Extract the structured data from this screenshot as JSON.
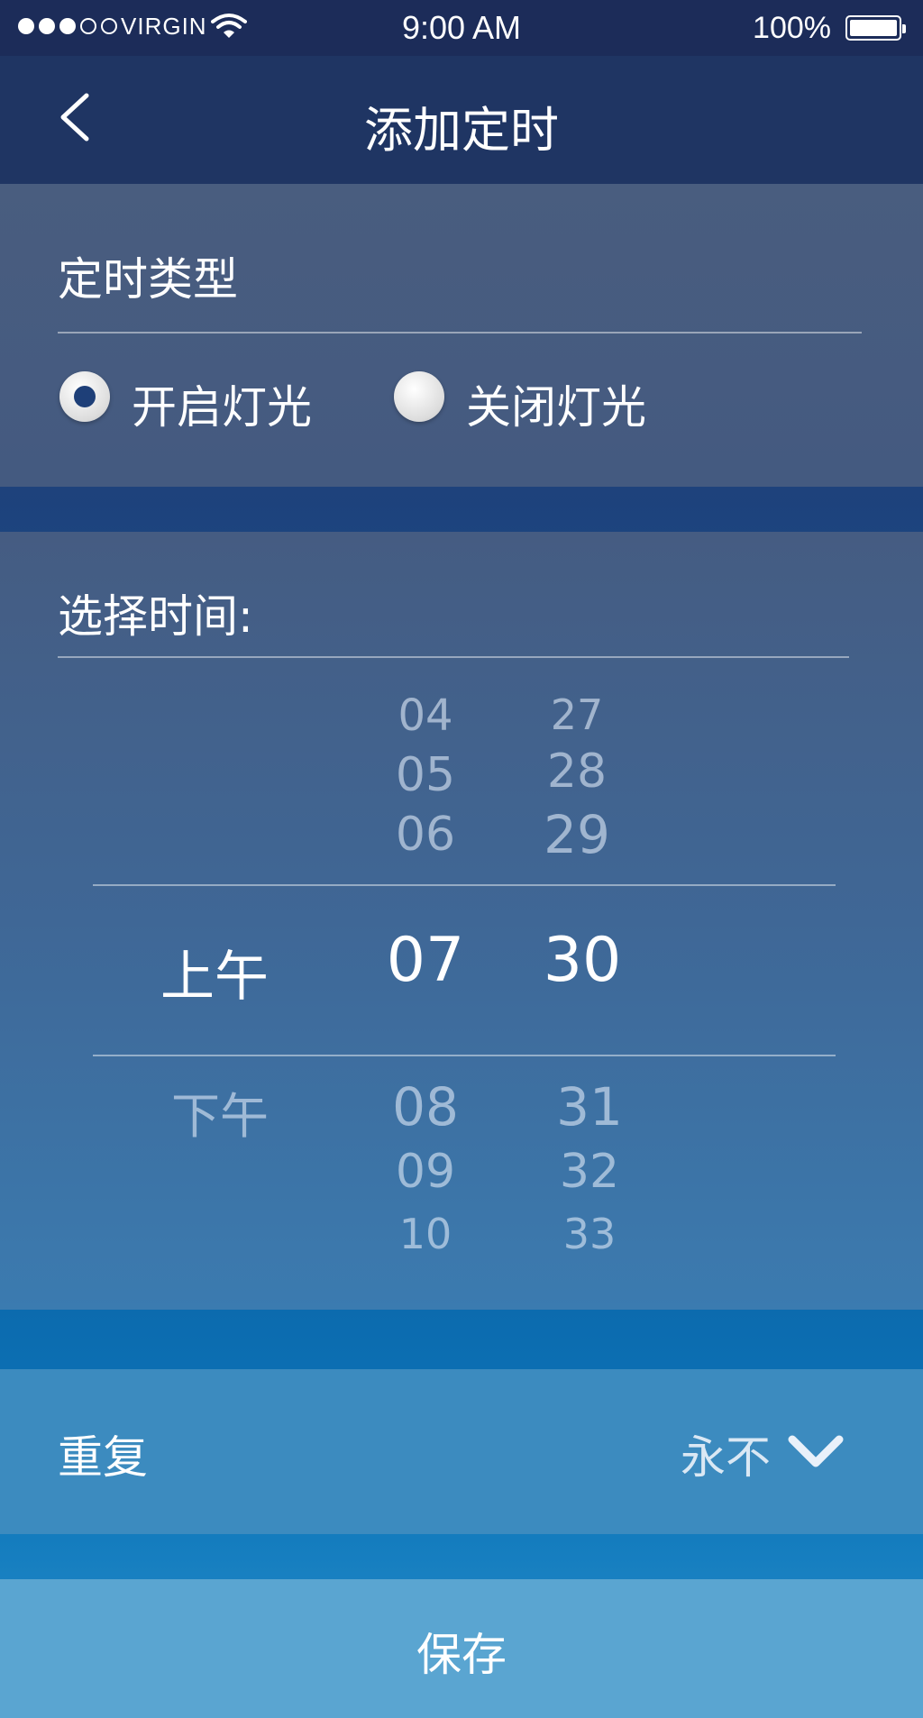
{
  "status_bar": {
    "carrier": "VIRGIN",
    "time": "9:00 AM",
    "battery": "100%",
    "signal_bars_filled": 3,
    "signal_bars_total": 5
  },
  "nav": {
    "title": "添加定时",
    "back_icon": "chevron-left-icon"
  },
  "timer_type": {
    "label": "定时类型",
    "options": [
      {
        "label": "开启灯光",
        "selected": true
      },
      {
        "label": "关闭灯光",
        "selected": false
      }
    ]
  },
  "time_picker": {
    "label": "选择时间:",
    "ampm": {
      "selected": "上午",
      "below": [
        "下午"
      ]
    },
    "hours": {
      "above": [
        "04",
        "05",
        "06"
      ],
      "selected": "07",
      "below": [
        "08",
        "09",
        "10"
      ]
    },
    "minutes": {
      "above": [
        "27",
        "28",
        "29"
      ],
      "selected": "30",
      "below": [
        "31",
        "32",
        "33"
      ]
    }
  },
  "repeat": {
    "label": "重复",
    "value": "永不",
    "icon": "chevron-down-icon"
  },
  "save_button": {
    "label": "保存"
  },
  "colors": {
    "status_bar": "#1c2c59",
    "nav_bar": "#1f3563",
    "save_bar": "#5aa5d1"
  }
}
